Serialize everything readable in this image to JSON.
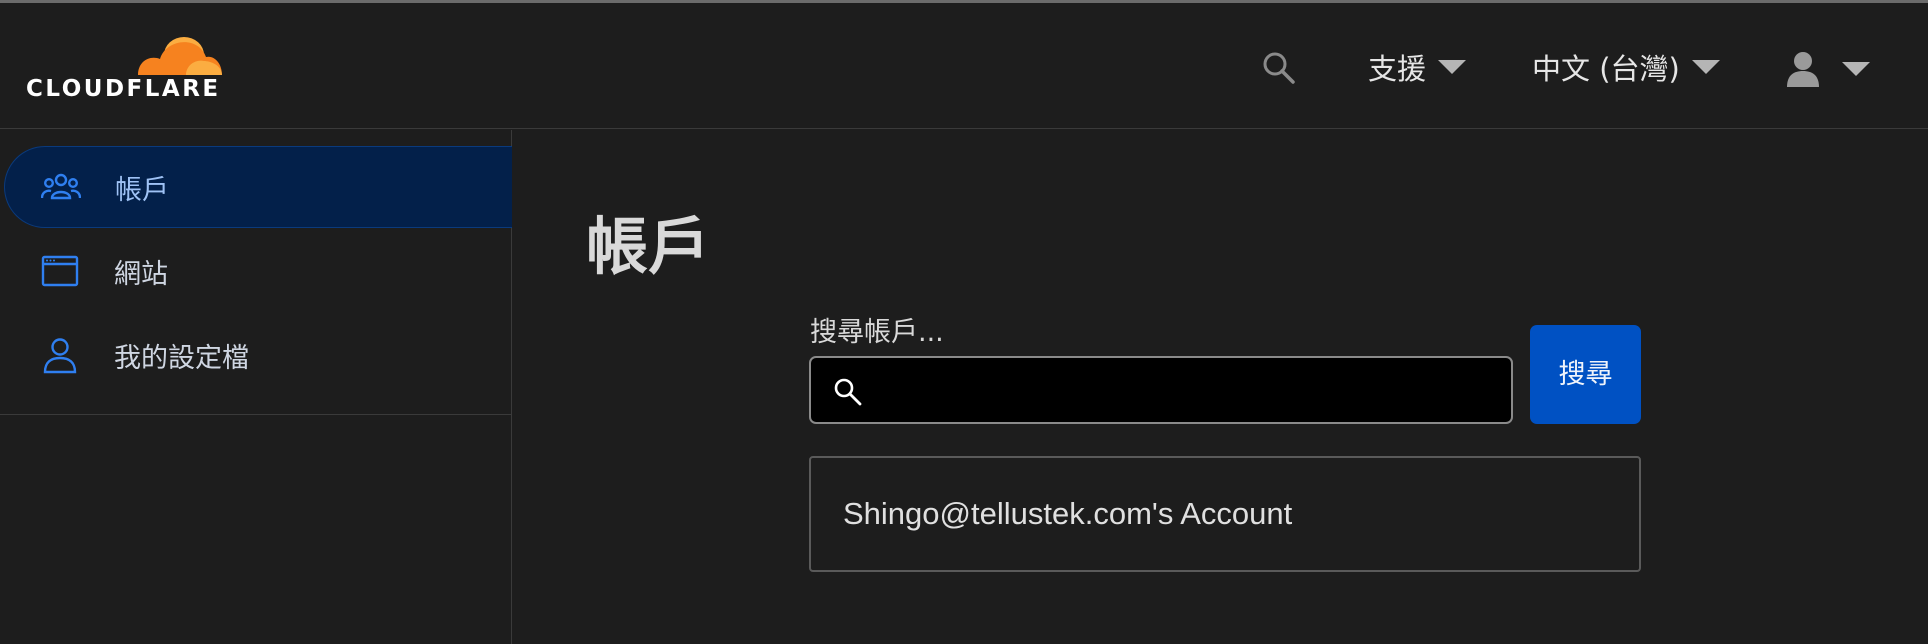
{
  "header": {
    "logo_text": "CLOUDFLARE",
    "brand_color": "#f6821f",
    "support_label": "支援",
    "language_label": "中文 (台灣)"
  },
  "sidebar": {
    "items": [
      {
        "label": "帳戶",
        "icon": "users-icon",
        "active": true
      },
      {
        "label": "網站",
        "icon": "browser-window-icon",
        "active": false
      },
      {
        "label": "我的設定檔",
        "icon": "user-profile-icon",
        "active": false
      }
    ],
    "accent_color": "#1a6fe0"
  },
  "main": {
    "title": "帳戶",
    "search": {
      "label": "搜尋帳戶...",
      "value": "",
      "button_label": "搜尋",
      "button_color": "#0051c3"
    },
    "accounts": [
      {
        "name": "Shingo@tellustek.com's Account"
      }
    ]
  }
}
